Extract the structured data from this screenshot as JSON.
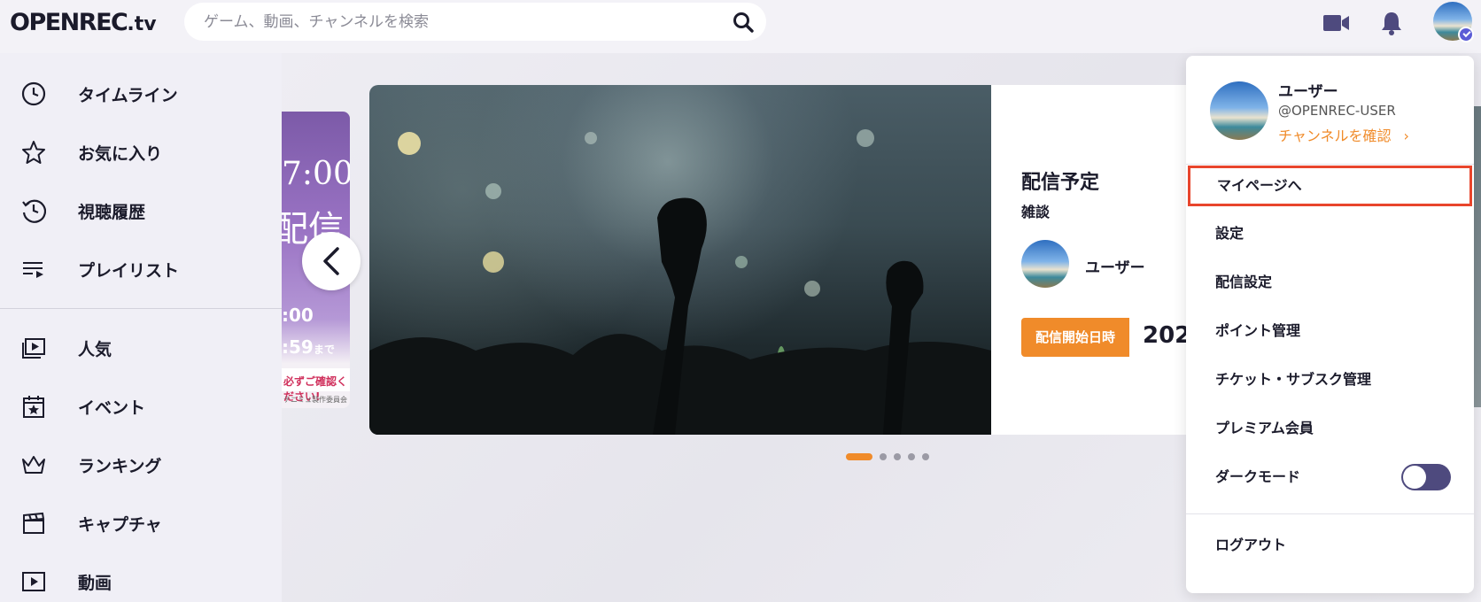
{
  "header": {
    "logo_main": "OPENREC",
    "logo_tv": ".tv",
    "search_placeholder": "ゲーム、動画、チャンネルを検索"
  },
  "sidebar": {
    "items": [
      {
        "label": "タイムライン",
        "icon": "clock-icon"
      },
      {
        "label": "お気に入り",
        "icon": "star-icon"
      },
      {
        "label": "視聴履歴",
        "icon": "history-icon"
      },
      {
        "label": "プレイリスト",
        "icon": "playlist-icon"
      },
      {
        "label": "人気",
        "icon": "play-box-icon"
      },
      {
        "label": "イベント",
        "icon": "calendar-star-icon"
      },
      {
        "label": "ランキング",
        "icon": "crown-icon"
      },
      {
        "label": "キャプチャ",
        "icon": "clapper-icon"
      },
      {
        "label": "動画",
        "icon": "video-icon"
      }
    ]
  },
  "prev_card": {
    "time_top": "7:00",
    "haishin": "配信",
    "time_mid": ":00",
    "time_end": ":59",
    "made": "まで",
    "notice": "必ずご確認ください!",
    "credit": "テニミュ製作委員会"
  },
  "hero": {
    "title": "配信予定",
    "category": "雑談",
    "user": "ユーザー",
    "badge": "配信開始日時",
    "date": "202"
  },
  "carousel": {
    "active_index": 0,
    "count": 5
  },
  "menu": {
    "name": "ユーザー",
    "handle": "@OPENREC-USER",
    "channel_link": "チャンネルを確認",
    "chevron": "›",
    "items": [
      "マイページへ",
      "設定",
      "配信設定",
      "ポイント管理",
      "チケット・サブスク管理",
      "プレミアム会員",
      "ダークモード"
    ],
    "dark_mode_on": true,
    "logout": "ログアウト"
  },
  "colors": {
    "accent": "#f08b2a",
    "highlight_border": "#e8452c",
    "toggle": "#4e4a7e"
  }
}
